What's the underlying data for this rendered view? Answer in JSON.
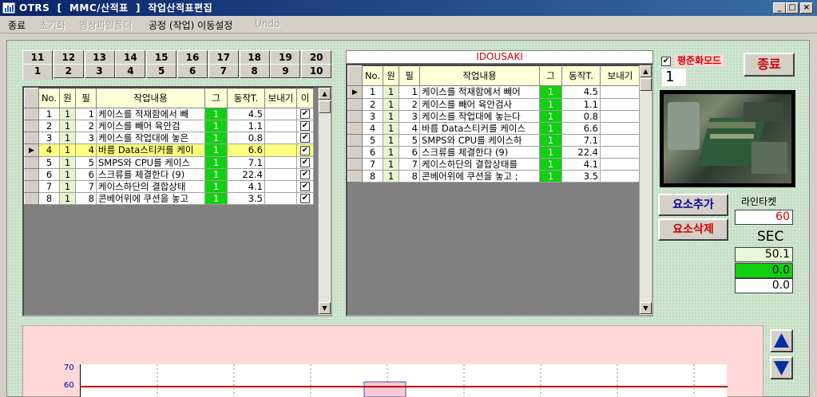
{
  "window": {
    "title": "OTRS  [  MMC/산적표  ]  작업산적표편집"
  },
  "menu": [
    {
      "label": "종료",
      "enabled": true
    },
    {
      "label": "초기화",
      "enabled": false
    },
    {
      "label": "영상파일폴더",
      "enabled": false
    },
    {
      "label": "공정 (작업) 이동설정",
      "enabled": true
    },
    {
      "label": "Undo",
      "enabled": false
    }
  ],
  "tabs": {
    "row_back": [
      "11",
      "12",
      "13",
      "14",
      "15",
      "16",
      "17",
      "18",
      "19",
      "20"
    ],
    "row_front": [
      "1",
      "2",
      "3",
      "4",
      "5",
      "6",
      "7",
      "8",
      "9",
      "10"
    ],
    "selected": "1"
  },
  "left_grid": {
    "headers": [
      "No.",
      "원",
      "필",
      "작업내용",
      "그",
      "동작T.",
      "보내기",
      "이"
    ],
    "rows": [
      {
        "no": "1",
        "won": "1",
        "pil": "1",
        "task": "케이스를 적재함에서 빼",
        "t": "4.5",
        "checked": true,
        "highlight": false
      },
      {
        "no": "2",
        "won": "1",
        "pil": "2",
        "task": "케이스를 빼어  육안검",
        "t": "1.1",
        "checked": true,
        "highlight": false
      },
      {
        "no": "3",
        "won": "1",
        "pil": "3",
        "task": "케이스를 작업대에 놓은",
        "t": "0.8",
        "checked": true,
        "highlight": false
      },
      {
        "no": "4",
        "won": "1",
        "pil": "4",
        "task": "바름 Data스티커를 케이",
        "t": "6.6",
        "checked": true,
        "highlight": true
      },
      {
        "no": "5",
        "won": "1",
        "pil": "5",
        "task": "SMPS와 CPU를 케이스",
        "t": "7.1",
        "checked": true,
        "highlight": false
      },
      {
        "no": "6",
        "won": "1",
        "pil": "6",
        "task": "스크류를 체결한다 (9)",
        "t": "22.4",
        "checked": true,
        "highlight": false
      },
      {
        "no": "7",
        "won": "1",
        "pil": "7",
        "task": "케이스하단의 결합상태",
        "t": "4.1",
        "checked": true,
        "highlight": false
      },
      {
        "no": "8",
        "won": "1",
        "pil": "8",
        "task": "콘베어위에 쿠션을 놓고",
        "t": "3.5",
        "checked": true,
        "highlight": false
      }
    ],
    "green_value": "1"
  },
  "right_grid": {
    "title": "IDOUSAKI",
    "headers": [
      "No.",
      "원",
      "필",
      "작업내용",
      "그",
      "동작T.",
      "보내기"
    ],
    "rows": [
      {
        "no": "1",
        "won": "1",
        "pil": "1",
        "task": "케이스를 적재함에서 빼어",
        "t": "4.5"
      },
      {
        "no": "2",
        "won": "1",
        "pil": "2",
        "task": "케이스를 빼어  육안검사",
        "t": "1.1"
      },
      {
        "no": "3",
        "won": "1",
        "pil": "3",
        "task": "케이스를 작업대에 놓는다",
        "t": "0.8"
      },
      {
        "no": "4",
        "won": "1",
        "pil": "4",
        "task": "바름 Data스티커를 케이스",
        "t": "6.6"
      },
      {
        "no": "5",
        "won": "1",
        "pil": "5",
        "task": "SMPS와 CPU를 케이스하",
        "t": "7.1"
      },
      {
        "no": "6",
        "won": "1",
        "pil": "6",
        "task": "스크류를 체결한다 (9)",
        "t": "22.4"
      },
      {
        "no": "7",
        "won": "1",
        "pil": "7",
        "task": "케이스하단의 결합상태를",
        "t": "4.1"
      },
      {
        "no": "8",
        "won": "1",
        "pil": "8",
        "task": "콘베어위에 쿠션을 놓고 ;",
        "t": "3.5"
      }
    ],
    "green_value": "1"
  },
  "right_panel": {
    "mode_label": "평준화모드",
    "mode_checked": true,
    "end_button": "종료",
    "count": "1",
    "add_button": "요소추가",
    "delete_button": "요소삭제",
    "line_tact_label": "라인타켓",
    "line_tact_value": "60",
    "unit": "SEC",
    "values": [
      "50.1",
      "0.0",
      "0.0"
    ]
  },
  "chart": {
    "y_ticks": [
      "70",
      "60"
    ],
    "target_line_value": 60
  },
  "colors": {
    "green": "#10d010",
    "highlight": "#ffff80",
    "accent_red": "#d00000",
    "accent_blue": "#0000a0"
  }
}
